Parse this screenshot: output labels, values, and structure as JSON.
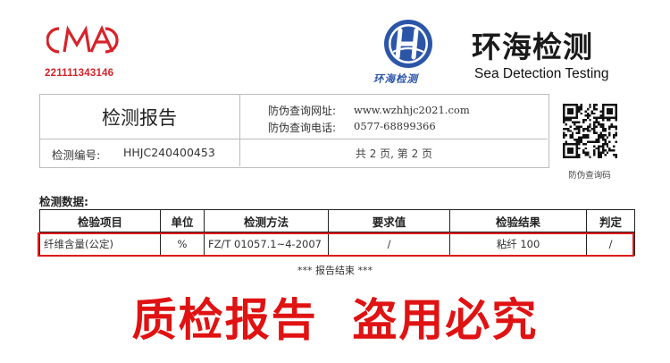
{
  "header": {
    "cma_logo_text": "CMA",
    "cma_number": "221111343146",
    "org_logo_caption": "环海检测",
    "org_name_cn": "环海检测",
    "org_name_en": "Sea Detection Testing"
  },
  "report": {
    "title": "检测报告",
    "number_label": "检测编号:",
    "number_value": "HHJC240400453",
    "web_label": "防伪查询网址:",
    "web_value": "www.wzhhjc2021.com",
    "tel_label": "防伪查询电话:",
    "tel_value": "0577-68899366",
    "page_info": "共 2 页, 第 2 页",
    "qr_caption": "防伪查询码"
  },
  "data_section": {
    "title": "检测数据:",
    "columns": [
      "检验项目",
      "单位",
      "检测方法",
      "要求值",
      "检验结果",
      "判定"
    ],
    "rows": [
      [
        "纤维含量(公定)",
        "%",
        "FZ/T 01057.1~4-2007",
        "/",
        "粘纤 100",
        "/"
      ]
    ],
    "end_note": "*** 报告结束 ***"
  },
  "warning": "质检报告  盗用必究",
  "colors": {
    "logo_red": "#d8232a",
    "logo_blue": "#2b56a8",
    "highlight_red": "#e01919"
  }
}
